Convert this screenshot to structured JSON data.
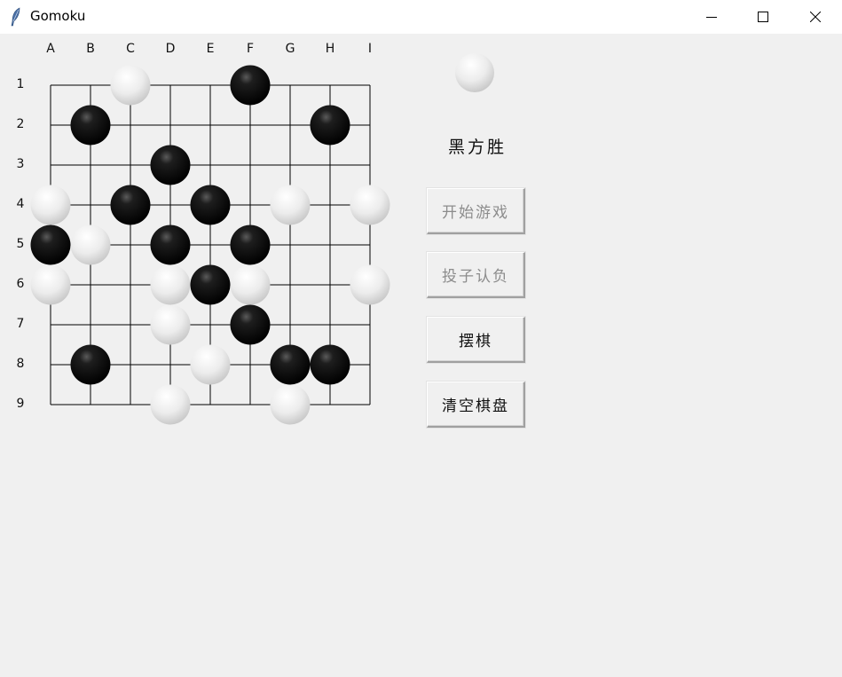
{
  "window": {
    "title": "Gomoku",
    "controls": [
      "minimize",
      "maximize",
      "close"
    ]
  },
  "board": {
    "columns": [
      "A",
      "B",
      "C",
      "D",
      "E",
      "F",
      "G",
      "H",
      "I"
    ],
    "rows": [
      "1",
      "2",
      "3",
      "4",
      "5",
      "6",
      "7",
      "8",
      "9"
    ],
    "stones": [
      {
        "col": "C",
        "row": 1,
        "color": "white"
      },
      {
        "col": "F",
        "row": 1,
        "color": "black"
      },
      {
        "col": "B",
        "row": 2,
        "color": "black"
      },
      {
        "col": "H",
        "row": 2,
        "color": "black"
      },
      {
        "col": "D",
        "row": 3,
        "color": "black"
      },
      {
        "col": "A",
        "row": 4,
        "color": "white"
      },
      {
        "col": "C",
        "row": 4,
        "color": "black"
      },
      {
        "col": "E",
        "row": 4,
        "color": "black"
      },
      {
        "col": "G",
        "row": 4,
        "color": "white"
      },
      {
        "col": "I",
        "row": 4,
        "color": "white"
      },
      {
        "col": "A",
        "row": 5,
        "color": "black"
      },
      {
        "col": "B",
        "row": 5,
        "color": "white"
      },
      {
        "col": "D",
        "row": 5,
        "color": "black"
      },
      {
        "col": "F",
        "row": 5,
        "color": "black"
      },
      {
        "col": "A",
        "row": 6,
        "color": "white"
      },
      {
        "col": "D",
        "row": 6,
        "color": "white"
      },
      {
        "col": "E",
        "row": 6,
        "color": "black"
      },
      {
        "col": "F",
        "row": 6,
        "color": "white"
      },
      {
        "col": "I",
        "row": 6,
        "color": "white"
      },
      {
        "col": "D",
        "row": 7,
        "color": "white"
      },
      {
        "col": "F",
        "row": 7,
        "color": "black"
      },
      {
        "col": "B",
        "row": 8,
        "color": "black"
      },
      {
        "col": "E",
        "row": 8,
        "color": "white"
      },
      {
        "col": "G",
        "row": 8,
        "color": "black"
      },
      {
        "col": "H",
        "row": 8,
        "color": "black"
      },
      {
        "col": "D",
        "row": 9,
        "color": "white"
      },
      {
        "col": "G",
        "row": 9,
        "color": "white"
      }
    ]
  },
  "panel": {
    "current_stone": "white",
    "status": "黑方胜",
    "buttons": [
      {
        "label": "开始游戏",
        "enabled": false
      },
      {
        "label": "投子认负",
        "enabled": false
      },
      {
        "label": "摆棋",
        "enabled": true
      },
      {
        "label": "清空棋盘",
        "enabled": true
      }
    ]
  },
  "colors": {
    "window_bg": "#f0f0f0",
    "titlebar_bg": "#ffffff",
    "grid_line": "#000000",
    "black_stone": "#0a0a0a",
    "white_stone": "#e8e8e8",
    "disabled_text": "#8c8c8c"
  }
}
